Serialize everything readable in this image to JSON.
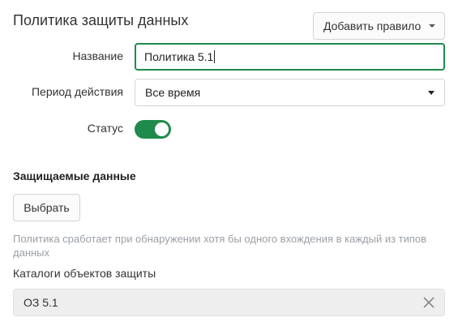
{
  "header": {
    "title": "Политика защиты данных",
    "add_rule_label": "Добавить правило"
  },
  "form": {
    "name_label": "Название",
    "name_value": "Политика 5.1",
    "period_label": "Период действия",
    "period_value": "Все время",
    "status_label": "Статус",
    "status_on": true
  },
  "protected_data": {
    "title": "Защищаемые данные",
    "choose_label": "Выбрать",
    "hint": "Политика сработает при обнаружении хотя бы одного вхождения в каждый из типов данных"
  },
  "catalogs": {
    "label": "Каталоги объектов защиты",
    "value": "ОЗ 5.1"
  },
  "colors": {
    "accent": "#1e8b4c",
    "hint_text": "#9aa0a6",
    "disabled_field": "#eeeeee"
  },
  "icons": {
    "dropdown": "chevron-down-icon",
    "clear": "close-icon"
  }
}
